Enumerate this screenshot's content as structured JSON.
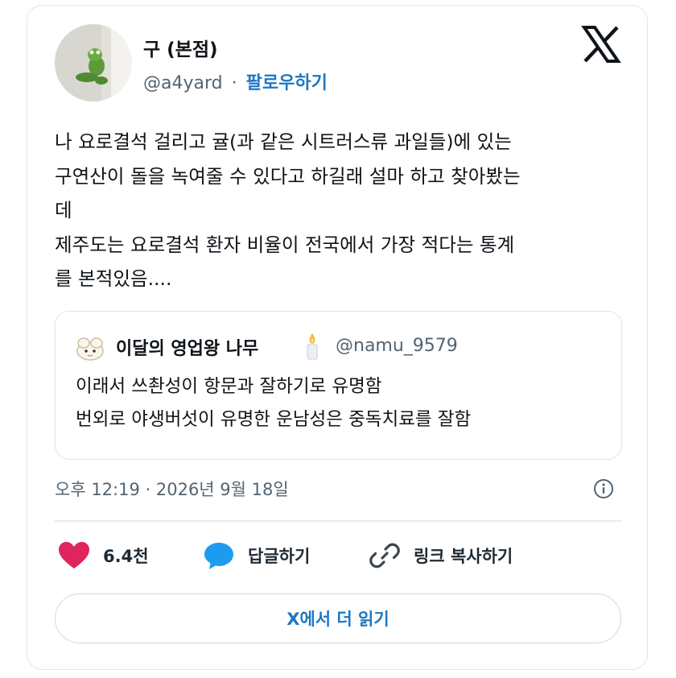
{
  "author": {
    "name": "구 (본점)",
    "handle": "@a4yard",
    "separator": "·",
    "follow_label": "팔로우하기"
  },
  "tweet": {
    "lines": [
      "나 요로결석 걸리고 귤(과 같은 시트러스류 과일들)에 있는",
      "구연산이 돌을 녹여줄 수 있다고 하길래 설마 하고 찾아봤는",
      "데",
      "제주도는 요로결석 환자 비율이 전국에서 가장 적다는 통계",
      "를 본적있음...."
    ]
  },
  "quote": {
    "name": "이달의 영업왕 나무",
    "handle": "@namu_9579",
    "lines": [
      "이래서 쓰촨성이 항문과 잘하기로 유명함",
      "번외로 야생버섯이 유명한 운남성은 중독치료를 잘함"
    ]
  },
  "timestamp": "오후 12:19 · 2026년 9월 18일",
  "actions": {
    "likes": "6.4천",
    "reply": "답글하기",
    "copy_link": "링크 복사하기"
  },
  "read_more": "X에서 더 읽기",
  "colors": {
    "link": "#1d77c4",
    "heart": "#f91880",
    "reply": "#1d9bf0",
    "muted": "#536471"
  },
  "icons": [
    "x-logo",
    "heart-icon",
    "reply-bubble-icon",
    "link-icon",
    "info-icon",
    "candle-emoji"
  ]
}
